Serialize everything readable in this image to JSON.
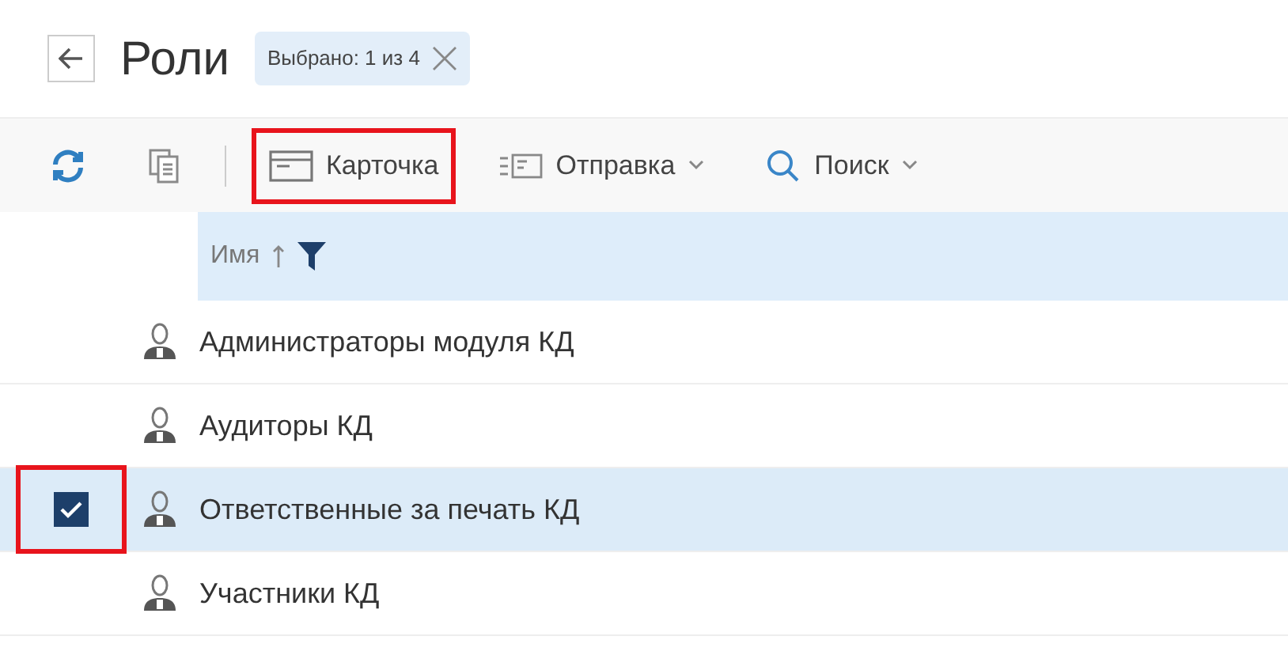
{
  "header": {
    "title": "Роли",
    "selection_badge": {
      "label": "Выбрано: 1 из 4"
    }
  },
  "toolbar": [
    {
      "kind": "refresh",
      "highlighted": false
    },
    {
      "kind": "copy",
      "highlighted": false
    },
    {
      "kind": "card",
      "label": "Карточка",
      "dropdown": false,
      "highlighted": true
    },
    {
      "kind": "send",
      "label": "Отправка",
      "dropdown": true,
      "highlighted": false
    },
    {
      "kind": "search",
      "label": "Поиск",
      "dropdown": true,
      "highlighted": false
    }
  ],
  "table": {
    "columns": [
      {
        "label": "Имя",
        "sort_ascending": true,
        "filtered": true
      }
    ],
    "rows": [
      {
        "name": "Администраторы модуля КД",
        "selected": false,
        "highlighted": false
      },
      {
        "name": "Аудиторы КД",
        "selected": false,
        "highlighted": false
      },
      {
        "name": "Ответственные за печать КД",
        "selected": true,
        "highlighted": true
      },
      {
        "name": "Участники КД",
        "selected": false,
        "highlighted": false
      }
    ]
  }
}
